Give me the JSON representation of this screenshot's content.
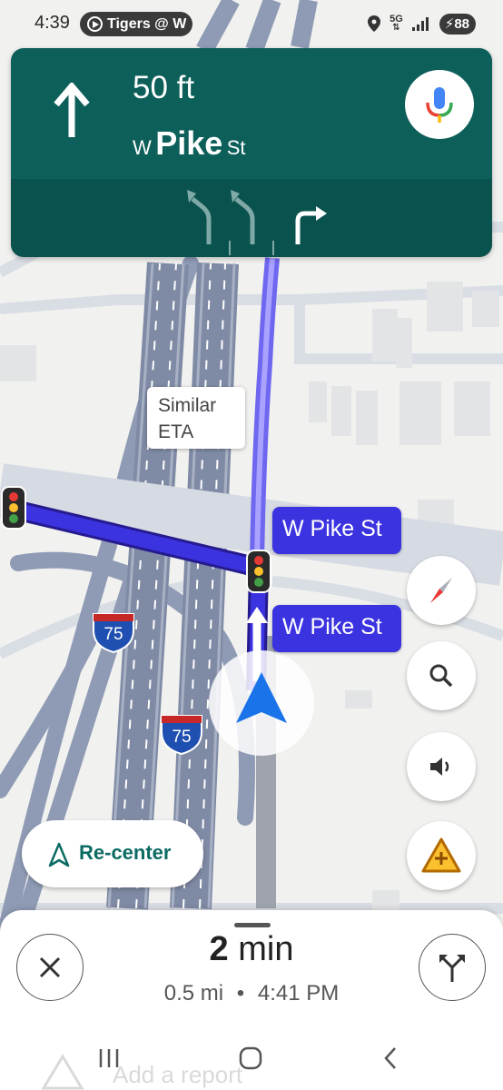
{
  "status_bar": {
    "time": "4:39",
    "media_pill": "Tigers @ W",
    "network": "5G",
    "battery": "88"
  },
  "direction": {
    "distance": "50 ft",
    "street_prefix": "W",
    "street_name": "Pike",
    "street_suffix": "St",
    "maneuver_icon": "arrow-straight-up-icon",
    "lanes": [
      "slight-left-lane-icon",
      "slight-left-lane-icon",
      "right-turn-lane-icon"
    ]
  },
  "map": {
    "route_callout_line1": "Similar",
    "route_callout_line2": "ETA",
    "street_label_1": "W Pike St",
    "street_label_2": "W Pike St",
    "highway_shield_1": "75",
    "highway_shield_2": "75"
  },
  "buttons": {
    "recenter_label": "Re-center"
  },
  "trip": {
    "duration_value": "2",
    "duration_unit": "min",
    "distance": "0.5 mi",
    "separator": "•",
    "arrival": "4:41 PM"
  },
  "background_report_label": "Add a report",
  "colors": {
    "banner": "#0d5f5a",
    "route": "#3c33e0",
    "accent": "#0b6b63"
  }
}
